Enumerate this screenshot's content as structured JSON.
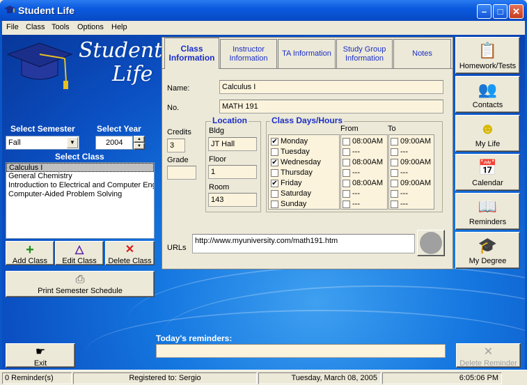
{
  "window": {
    "title": "Student Life"
  },
  "menu": [
    "File",
    "Class",
    "Tools",
    "Options",
    "Help"
  ],
  "logo": {
    "line1": "Student",
    "line2": "Life"
  },
  "semester": {
    "label": "Select Semester",
    "value": "Fall"
  },
  "year": {
    "label": "Select Year",
    "value": "2004"
  },
  "class_list": {
    "label": "Select Class",
    "items": [
      "Calculus I",
      "General Chemistry",
      "Introduction to Electrical and Computer Engi",
      "Computer-Aided Problem Solving"
    ],
    "selected": 0
  },
  "class_buttons": {
    "add": "Add Class",
    "edit": "Edit Class",
    "delete": "Delete Class",
    "print": "Print Semester Schedule"
  },
  "tabs": [
    {
      "label": "Class Information",
      "active": true
    },
    {
      "label": "Instructor Information",
      "active": false
    },
    {
      "label": "TA Information",
      "active": false
    },
    {
      "label": "Study Group Information",
      "active": false
    },
    {
      "label": "Notes",
      "active": false
    }
  ],
  "class_info": {
    "name_label": "Name:",
    "name": "Calculus I",
    "no_label": "No.",
    "no": "MATH 191",
    "credits_label": "Credits",
    "credits": "3",
    "grade_label": "Grade",
    "grade": "",
    "location": {
      "title": "Location",
      "bldg_label": "Bldg",
      "bldg": "JT Hall",
      "floor_label": "Floor",
      "floor": "1",
      "room_label": "Room",
      "room": "143"
    },
    "schedule": {
      "title": "Class Days/Hours",
      "from_label": "From",
      "to_label": "To",
      "days": [
        {
          "day": "Monday",
          "checked": true,
          "from": "08:00AM",
          "from_checked": false,
          "to": "09:00AM",
          "to_checked": false
        },
        {
          "day": "Tuesday",
          "checked": false,
          "from": "---",
          "from_checked": false,
          "to": "---",
          "to_checked": false
        },
        {
          "day": "Wednesday",
          "checked": true,
          "from": "08:00AM",
          "from_checked": false,
          "to": "09:00AM",
          "to_checked": false
        },
        {
          "day": "Thursday",
          "checked": false,
          "from": "---",
          "from_checked": false,
          "to": "---",
          "to_checked": false
        },
        {
          "day": "Friday",
          "checked": true,
          "from": "08:00AM",
          "from_checked": false,
          "to": "09:00AM",
          "to_checked": false
        },
        {
          "day": "Saturday",
          "checked": false,
          "from": "---",
          "from_checked": false,
          "to": "---",
          "to_checked": false
        },
        {
          "day": "Sunday",
          "checked": false,
          "from": "---",
          "from_checked": false,
          "to": "---",
          "to_checked": false
        }
      ]
    },
    "urls_label": "URLs",
    "url": "http://www.myuniversity.com/math191.htm"
  },
  "side_buttons": [
    {
      "label": "Homework/Tests",
      "icon": "homework-icon"
    },
    {
      "label": "Contacts",
      "icon": "contacts-icon"
    },
    {
      "label": "My Life",
      "icon": "smiley-icon"
    },
    {
      "label": "Calendar",
      "icon": "calendar-icon"
    },
    {
      "label": "Reminders",
      "icon": "reminders-icon"
    },
    {
      "label": "My Degree",
      "icon": "graduation-cap-icon"
    }
  ],
  "reminders": {
    "label": "Today's reminders:",
    "value": "",
    "delete_label": "Delete Reminder"
  },
  "exit_label": "Exit",
  "status": {
    "reminders": "0 Reminder(s)",
    "registered": "Registered to: Sergio",
    "date": "Tuesday, March 08, 2005",
    "time": "6:05:06 PM"
  },
  "colors": {
    "accent": "#1a2ec8",
    "title_bar": "#0a5ae0",
    "field_bg": "#fbf3dc",
    "close": "#c73b1e"
  }
}
